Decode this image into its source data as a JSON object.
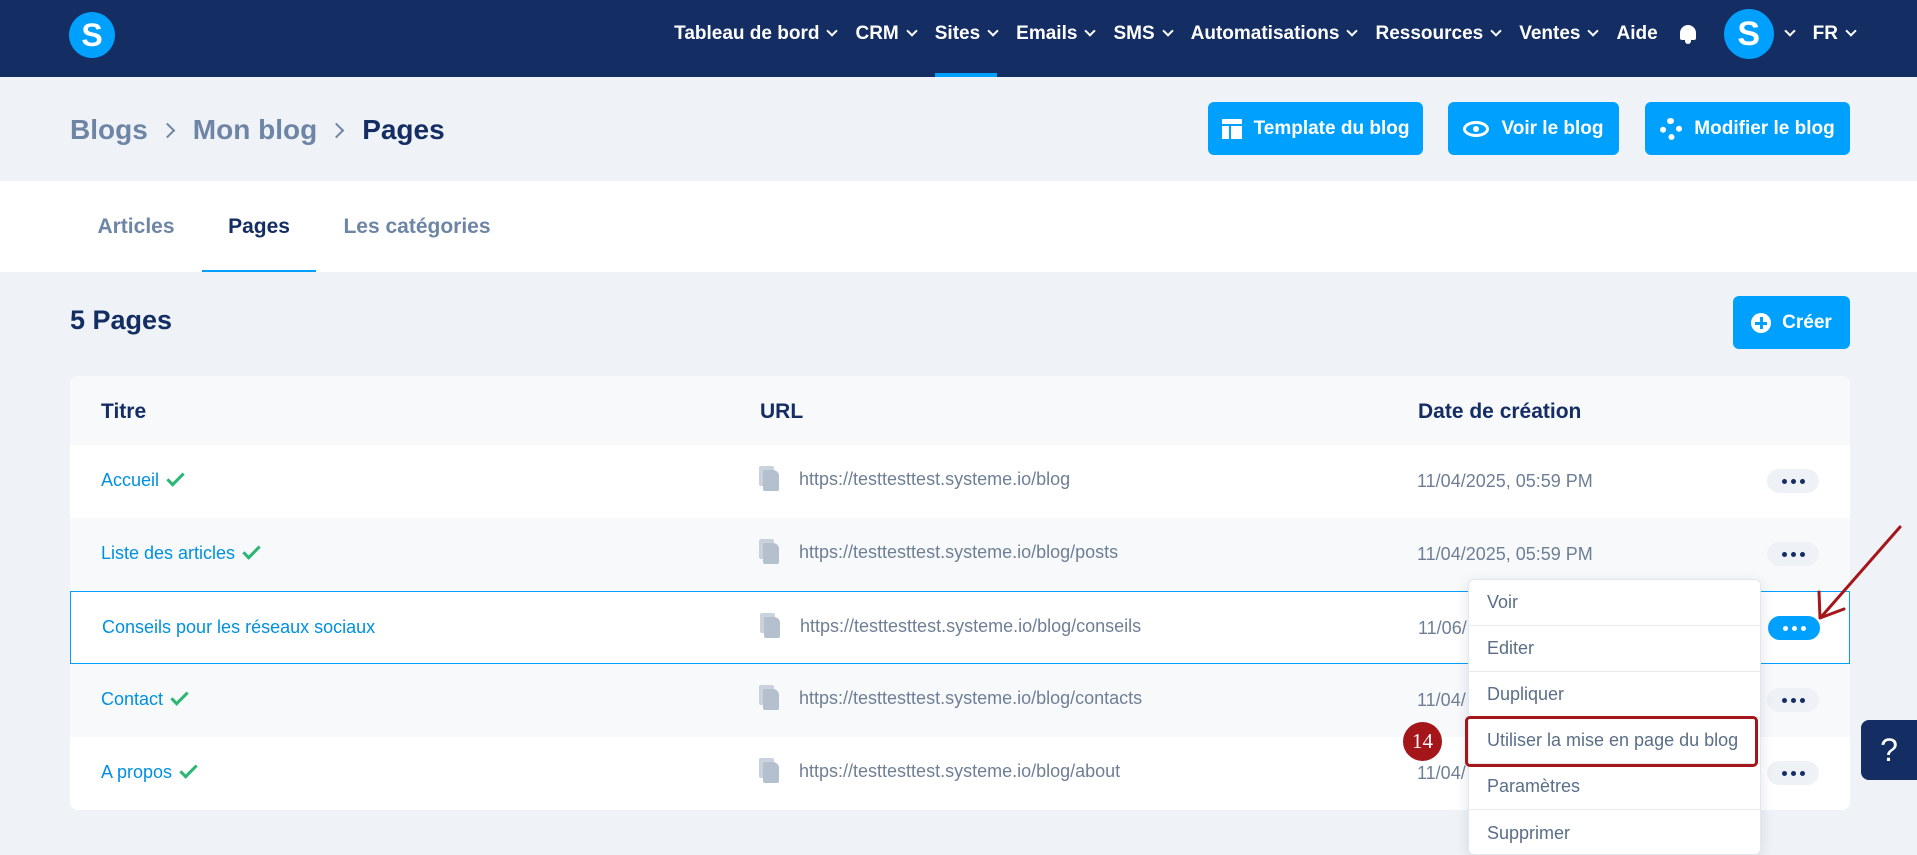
{
  "nav": {
    "logo": "S",
    "items": [
      {
        "label": "Tableau de bord",
        "dropdown": true,
        "active": false
      },
      {
        "label": "CRM",
        "dropdown": true,
        "active": false
      },
      {
        "label": "Sites",
        "dropdown": true,
        "active": true
      },
      {
        "label": "Emails",
        "dropdown": true,
        "active": false
      },
      {
        "label": "SMS",
        "dropdown": true,
        "active": false
      },
      {
        "label": "Automatisations",
        "dropdown": true,
        "active": false
      },
      {
        "label": "Ressources",
        "dropdown": true,
        "active": false
      },
      {
        "label": "Ventes",
        "dropdown": true,
        "active": false
      },
      {
        "label": "Aide",
        "dropdown": false,
        "active": false
      }
    ],
    "avatar": "S",
    "language": "FR"
  },
  "breadcrumb": [
    {
      "label": "Blogs"
    },
    {
      "label": "Mon blog"
    },
    {
      "label": "Pages"
    }
  ],
  "header_buttons": {
    "template": "Template du blog",
    "view": "Voir le blog",
    "edit": "Modifier le blog"
  },
  "tabs": [
    {
      "label": "Articles",
      "active": false
    },
    {
      "label": "Pages",
      "active": true
    },
    {
      "label": "Les catégories",
      "active": false
    }
  ],
  "section": {
    "title": "5 Pages",
    "create_label": "Créer"
  },
  "table": {
    "headers": {
      "title": "Titre",
      "url": "URL",
      "date": "Date de création"
    },
    "rows": [
      {
        "title": "Accueil",
        "published": true,
        "url": "https://testtesttest.systeme.io/blog",
        "date": "11/04/2025, 05:59 PM"
      },
      {
        "title": "Liste des articles",
        "published": true,
        "url": "https://testtesttest.systeme.io/blog/posts",
        "date": "11/04/2025, 05:59 PM"
      },
      {
        "title": "Conseils pour les réseaux sociaux",
        "published": false,
        "url": "https://testtesttest.systeme.io/blog/conseils",
        "date": "11/06/"
      },
      {
        "title": "Contact",
        "published": true,
        "url": "https://testtesttest.systeme.io/blog/contacts",
        "date": "11/04/"
      },
      {
        "title": "A propos",
        "published": true,
        "url": "https://testtesttest.systeme.io/blog/about",
        "date": "11/04/"
      }
    ]
  },
  "menu": {
    "items": [
      "Voir",
      "Editer",
      "Dupliquer",
      "Utiliser la mise en page du blog",
      "Paramètres",
      "Supprimer"
    ],
    "highlighted": "Utiliser la mise en page du blog"
  },
  "annotation": {
    "step": "14",
    "color": "#a4161a"
  },
  "help": {
    "label": "?"
  },
  "colors": {
    "navy": "#142d63",
    "accent": "#00a0ff",
    "check": "#2bb673",
    "background": "#eff3f7"
  }
}
